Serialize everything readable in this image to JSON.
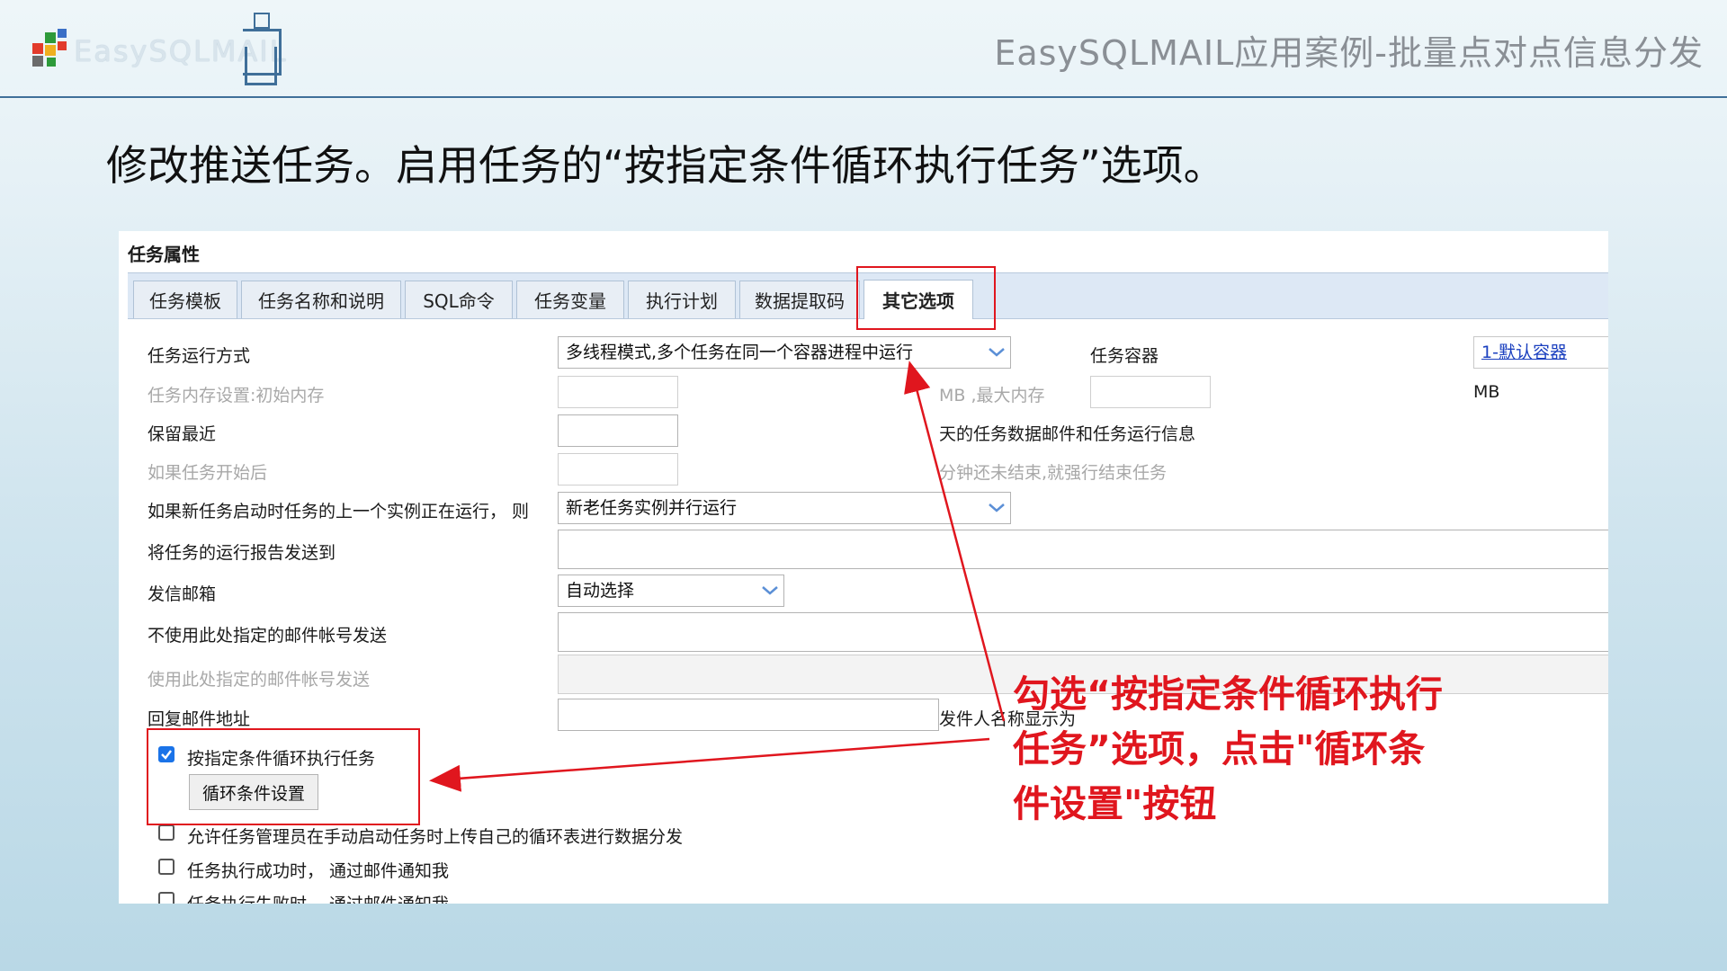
{
  "header": {
    "logo_text": "EasySQLMAIL",
    "title": "EasySQLMAIL应用案例-批量点对点信息分发"
  },
  "instruction": "修改推送任务。启用任务的“按指定条件循环执行任务”选项。",
  "panel": {
    "title": "任务属性",
    "tabs": [
      "任务模板",
      "任务名称和说明",
      "SQL命令",
      "任务变量",
      "执行计划",
      "数据提取码",
      "其它选项"
    ],
    "active_tab": "其它选项"
  },
  "form": {
    "run_mode_label": "任务运行方式",
    "run_mode_value": "多线程模式,多个任务在同一个容器进程中运行",
    "container_label": "任务容器",
    "container_value": "1-默认容器",
    "memory_label": "任务内存设置:初始内存",
    "memory_max_label": "MB ,最大内存",
    "memory_unit": "MB",
    "keep_label": "保留最近",
    "keep_suffix": "天的任务数据邮件和任务运行信息",
    "timeout_label": "如果任务开始后",
    "timeout_suffix": "分钟还未结束,就强行结束任务",
    "overlap_label": "如果新任务启动时任务的上一个实例正在运行， 则",
    "overlap_value": "新老任务实例并行运行",
    "report_label": "将任务的运行报告发送到",
    "sender_label": "发信邮箱",
    "sender_value": "自动选择",
    "exclude_label": "不使用此处指定的邮件帐号发送",
    "use_label": "使用此处指定的邮件帐号发送",
    "reply_label": "回复邮件地址",
    "display_name_label": "发件人名称显示为",
    "loop_checkbox_label": "按指定条件循环执行任务",
    "loop_checked": true,
    "loop_button": "循环条件设置",
    "allow_upload_label": "允许任务管理员在手动启动任务时上传自己的循环表进行数据分发",
    "notify_success_label": "任务执行成功时， 通过邮件通知我",
    "notify_fail_label": "任务执行失败时， 通过邮件通知我"
  },
  "annotation": {
    "line1": "勾选“按指定条件循环执行",
    "line2": "任务”选项，点击\"循环条",
    "line3": "件设置\"按钮"
  },
  "colors": {
    "accent_red": "#e0161e",
    "header_blue": "#3f6f99",
    "checkbox_blue": "#1a73e8",
    "link_blue": "#1a3fbf"
  }
}
